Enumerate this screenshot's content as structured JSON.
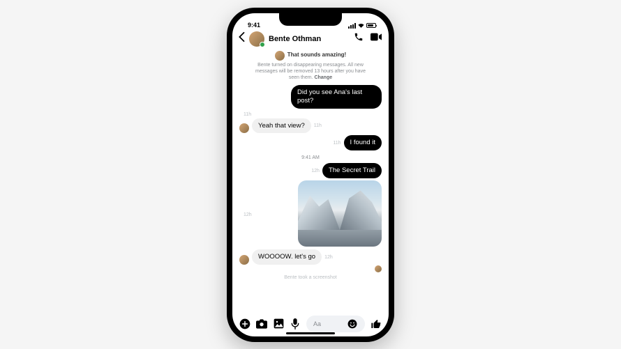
{
  "status": {
    "time": "9:41"
  },
  "header": {
    "contact_name": "Bente Othman"
  },
  "system_msg": {
    "truncated_prev": "That sounds amazing!",
    "text_pre": "Bente turned on disappearing messages. All new messages will be removed 13 hours after you have seen them.",
    "change": "Change"
  },
  "thread": {
    "m1": {
      "text": "Did you see Ana's last post?",
      "ts": "11h"
    },
    "m2": {
      "text": "Yeah that view?",
      "ts": "11h"
    },
    "m3": {
      "text": "I found it",
      "ts": "11h"
    },
    "day": "9:41 AM",
    "m4": {
      "text": "The Secret Trail",
      "ts": "12h"
    },
    "img_ts": "12h",
    "m5": {
      "text": "WOOOOW. let's go",
      "ts": "12h"
    }
  },
  "footer": {
    "screenshot_notice": "Bente took a screenshot",
    "placeholder": "Aa"
  }
}
